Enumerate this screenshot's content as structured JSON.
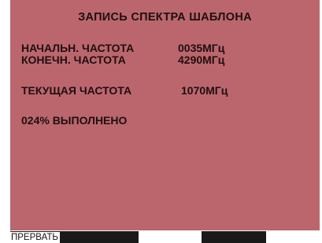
{
  "screen": {
    "title": "ЗАПИСЬ СПЕКТРА ШАБЛОНА",
    "start_freq": {
      "label": "НАЧАЛЬН. ЧАСТОТА",
      "value": "0035МГц"
    },
    "stop_freq": {
      "label": "КОНЕЧН. ЧАСТОТА",
      "value": "4290МГц"
    },
    "current_freq": {
      "label": "ТЕКУЩАЯ ЧАСТОТА",
      "value": "1070МГц"
    },
    "progress_text": "024% ВЫПОЛНЕНО",
    "progress_percent": 24
  },
  "softkeys": {
    "abort_label": "ПРЕРВАТЬ"
  },
  "colors": {
    "screen_background": "#bb666d",
    "text": "#1f0f10",
    "softkey": "#1a1a1a"
  }
}
